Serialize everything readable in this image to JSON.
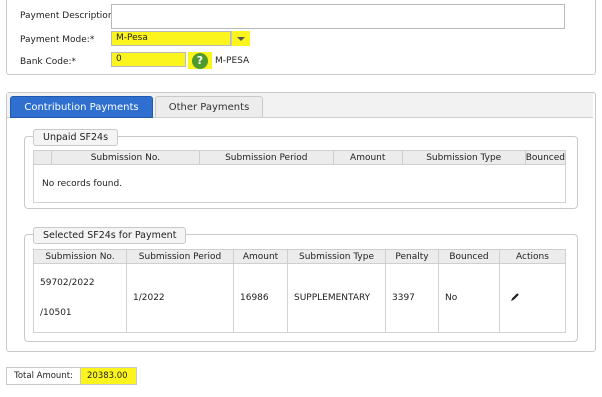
{
  "form": {
    "description_label": "Payment Description:",
    "description_value": "",
    "mode_label": "Payment Mode:*",
    "mode_value": "M-Pesa",
    "bank_label": "Bank Code:*",
    "bank_value": "0",
    "bank_name": "M-PESA"
  },
  "tabs": [
    {
      "label": "Contribution Payments",
      "active": true
    },
    {
      "label": "Other Payments",
      "active": false
    }
  ],
  "unpaid": {
    "legend": "Unpaid SF24s",
    "columns": [
      "",
      "Submission No.",
      "Submission Period",
      "Amount",
      "Submission Type",
      "Bounced"
    ],
    "empty_text": "No records found."
  },
  "selected": {
    "legend": "Selected SF24s for Payment",
    "columns": [
      "Submission No.",
      "Submission Period",
      "Amount",
      "Submission Type",
      "Penalty",
      "Bounced",
      "Actions"
    ],
    "rows": [
      {
        "submission_no_line1": "59702/2022",
        "submission_no_line2": "/10501",
        "period": "1/2022",
        "amount": "16986",
        "type": "SUPPLEMENTARY",
        "penalty": "3397",
        "bounced": "No",
        "action_icon": "pencil-icon"
      }
    ]
  },
  "total": {
    "label": "Total Amount:",
    "value": "20383.00"
  },
  "colors": {
    "highlight": "#fbf51d",
    "tab_active": "#2f6fcf",
    "help_green": "#4f9a2c"
  }
}
